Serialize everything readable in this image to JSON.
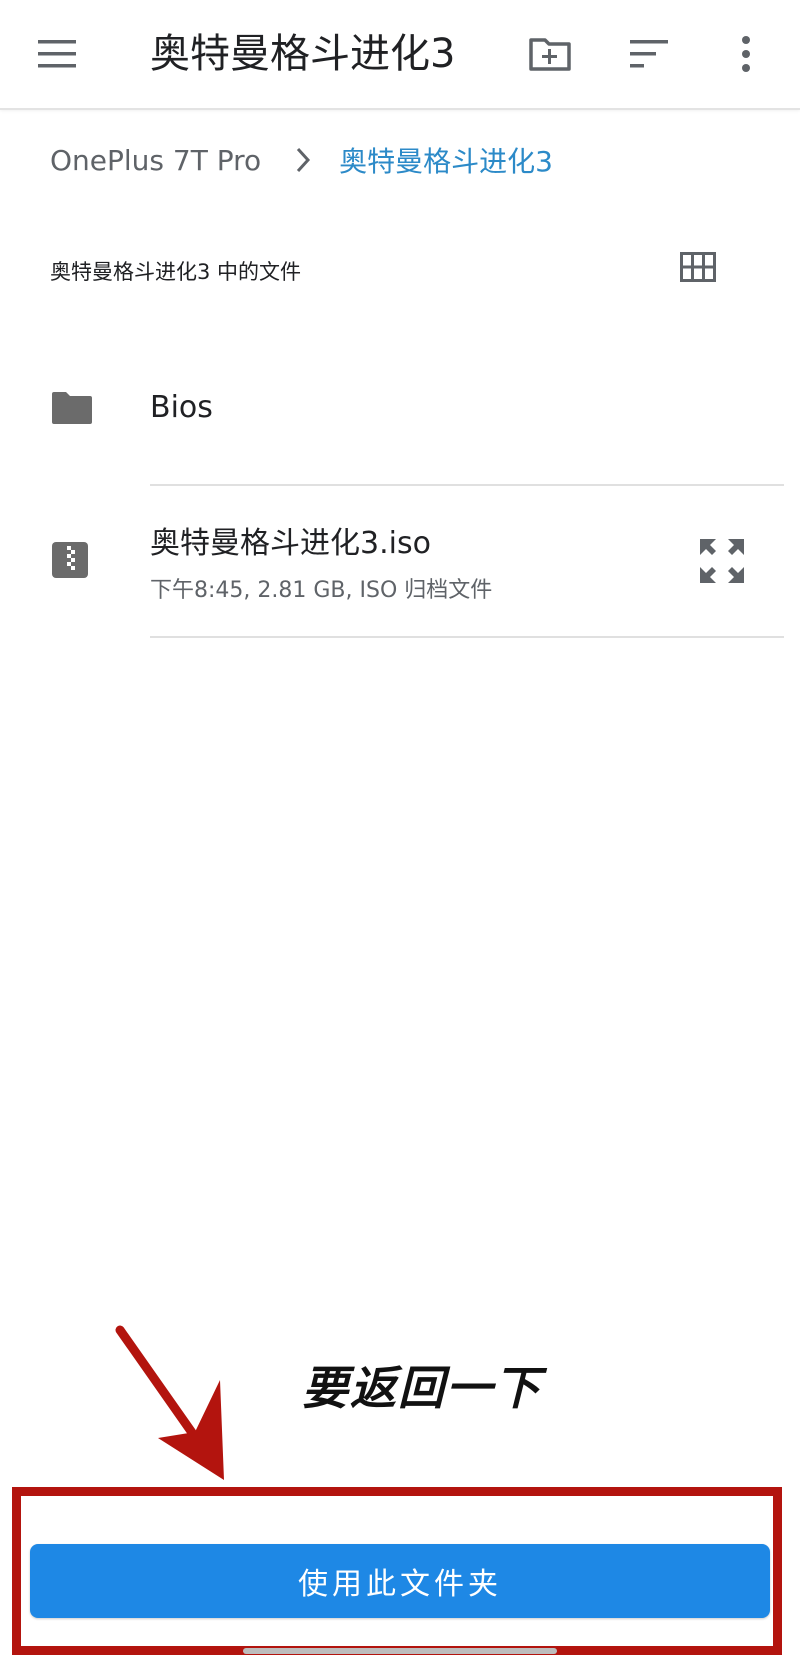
{
  "appbar": {
    "title": "奥特曼格斗进化3",
    "icons": [
      "menu-icon",
      "new-folder-icon",
      "sort-icon",
      "more-vert-icon"
    ]
  },
  "breadcrumb": {
    "root": "OnePlus 7T Pro",
    "current": "奥特曼格斗进化3"
  },
  "section": {
    "title": "奥特曼格斗进化3 中的文件"
  },
  "files": [
    {
      "name": "Bios",
      "type": "folder",
      "icon": "folder-icon"
    },
    {
      "name": "奥特曼格斗进化3.iso",
      "meta": "下午8:45, 2.81 GB, ISO 归档文件",
      "icon": "zip-file-icon"
    }
  ],
  "annotation": {
    "text": "要返回一下"
  },
  "footer": {
    "primary_button": "使用此文件夹"
  },
  "colors": {
    "accent_blue": "#1e88e5",
    "breadcrumb_active": "#2c8ac8",
    "annotation_red": "#b3140e"
  }
}
